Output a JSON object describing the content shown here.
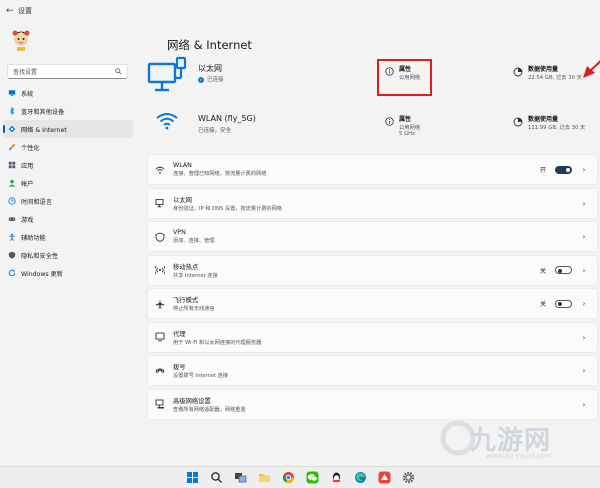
{
  "window": {
    "back_icon": "back-arrow-icon",
    "title": "设置"
  },
  "sidebar": {
    "search_placeholder": "查找设置",
    "items": [
      {
        "label": "系统",
        "icon": "system-icon",
        "color": "#0078d4"
      },
      {
        "label": "蓝牙和其他设备",
        "icon": "bluetooth-icon",
        "color": "#0078d4"
      },
      {
        "label": "网络 & Internet",
        "icon": "network-icon",
        "color": "#0078d4",
        "active": true
      },
      {
        "label": "个性化",
        "icon": "brush-icon",
        "color": "#e67e22"
      },
      {
        "label": "应用",
        "icon": "apps-icon",
        "color": "#4a5568"
      },
      {
        "label": "帐户",
        "icon": "account-icon",
        "color": "#2ea44f"
      },
      {
        "label": "时间和语言",
        "icon": "globe-clock-icon",
        "color": "#0078d4"
      },
      {
        "label": "游戏",
        "icon": "gamepad-icon",
        "color": "#555555"
      },
      {
        "label": "辅助功能",
        "icon": "accessibility-icon",
        "color": "#0078d4"
      },
      {
        "label": "隐私和安全性",
        "icon": "shield-icon",
        "color": "#555555"
      },
      {
        "label": "Windows 更新",
        "icon": "update-icon",
        "color": "#0078d4"
      }
    ]
  },
  "main": {
    "title": "网络 & Internet",
    "ethernet": {
      "name": "以太网",
      "status": "已连接",
      "prop_title": "属性",
      "prop_sub": "公用网络",
      "usage_title": "数据使用量",
      "usage_sub": "22.54 GB, 过去 30 天"
    },
    "wlan": {
      "name": "WLAN (fly_5G)",
      "status": "已连接，安全",
      "prop_title": "属性",
      "prop_sub": "公用网络",
      "prop_sub2": "5 GHz",
      "usage_title": "数据使用量",
      "usage_sub": "111.99 GB, 过去 30 天"
    },
    "cards": [
      {
        "icon": "wifi-icon",
        "title": "WLAN",
        "sub": "连接、管理已知网络，按流量计费的网络",
        "state": "开",
        "toggle": "on"
      },
      {
        "icon": "ethernet-icon",
        "title": "以太网",
        "sub": "身份验证、IP 和 DNS 设置，按流量计费的网络",
        "state": "",
        "toggle": ""
      },
      {
        "icon": "vpn-shield-icon",
        "title": "VPN",
        "sub": "添加、连接、管理",
        "state": "",
        "toggle": ""
      },
      {
        "icon": "hotspot-icon",
        "title": "移动热点",
        "sub": "共享 Internet 连接",
        "state": "关",
        "toggle": "off"
      },
      {
        "icon": "airplane-icon",
        "title": "飞行模式",
        "sub": "停止所有无线通信",
        "state": "关",
        "toggle": "off"
      },
      {
        "icon": "proxy-icon",
        "title": "代理",
        "sub": "用于 Wi-Fi 和以太网连接的代理服务器",
        "state": "",
        "toggle": ""
      },
      {
        "icon": "dialup-icon",
        "title": "拨号",
        "sub": "设置拨号 Internet 连接",
        "state": "",
        "toggle": ""
      },
      {
        "icon": "advanced-network-icon",
        "title": "高级网络设置",
        "sub": "查看所有网络适配器，网络重置",
        "state": "",
        "toggle": ""
      }
    ]
  },
  "annotation": {
    "highlight_color": "#e01b1b"
  },
  "taskbar": {
    "icons": [
      "windows-start-icon",
      "search-icon",
      "task-view-icon",
      "file-explorer-icon",
      "chrome-icon",
      "wechat-icon",
      "qq-icon",
      "edge-icon",
      "app-icon",
      "settings-icon"
    ]
  },
  "watermark": {
    "text": "九游网",
    "url": "www.jiu-youxi.com"
  }
}
